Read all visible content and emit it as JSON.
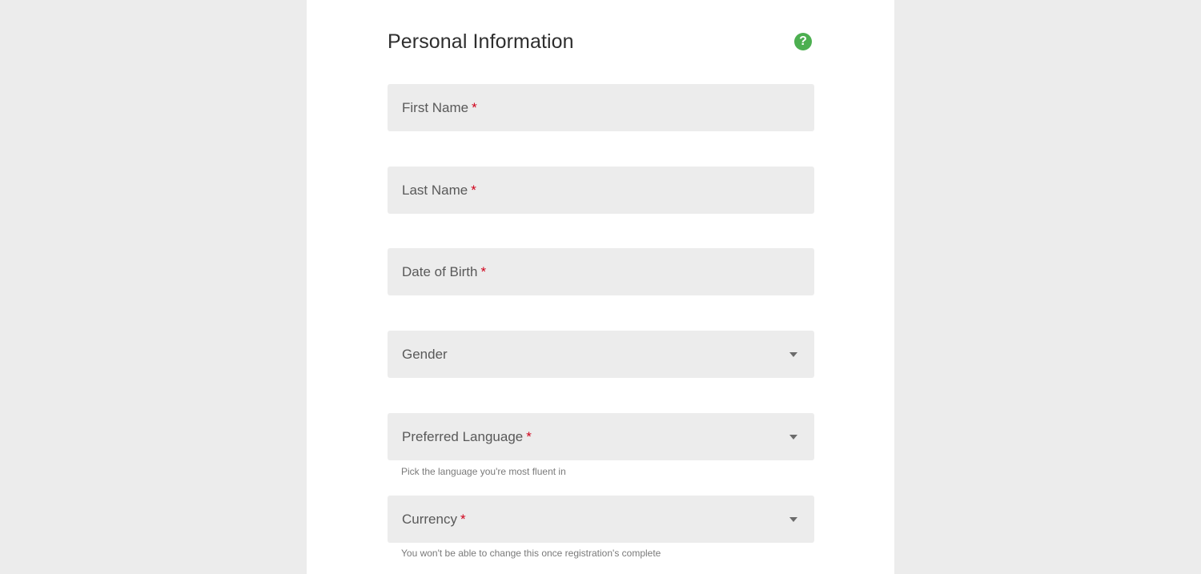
{
  "form": {
    "title": "Personal Information",
    "help_icon": "question-circle-icon",
    "accent_color": "#4caf50",
    "required_color": "#d0021b",
    "required_marker": "*",
    "fields": [
      {
        "label": "First Name",
        "required": true,
        "type": "text"
      },
      {
        "label": "Last Name",
        "required": true,
        "type": "text"
      },
      {
        "label": "Date of Birth",
        "required": true,
        "type": "text"
      },
      {
        "label": "Gender",
        "required": false,
        "type": "select"
      },
      {
        "label": "Preferred Language",
        "required": true,
        "type": "select",
        "hint": "Pick the language you're most fluent in"
      },
      {
        "label": "Currency",
        "required": true,
        "type": "select",
        "hint": "You won't be able to change this once registration's complete"
      }
    ]
  }
}
